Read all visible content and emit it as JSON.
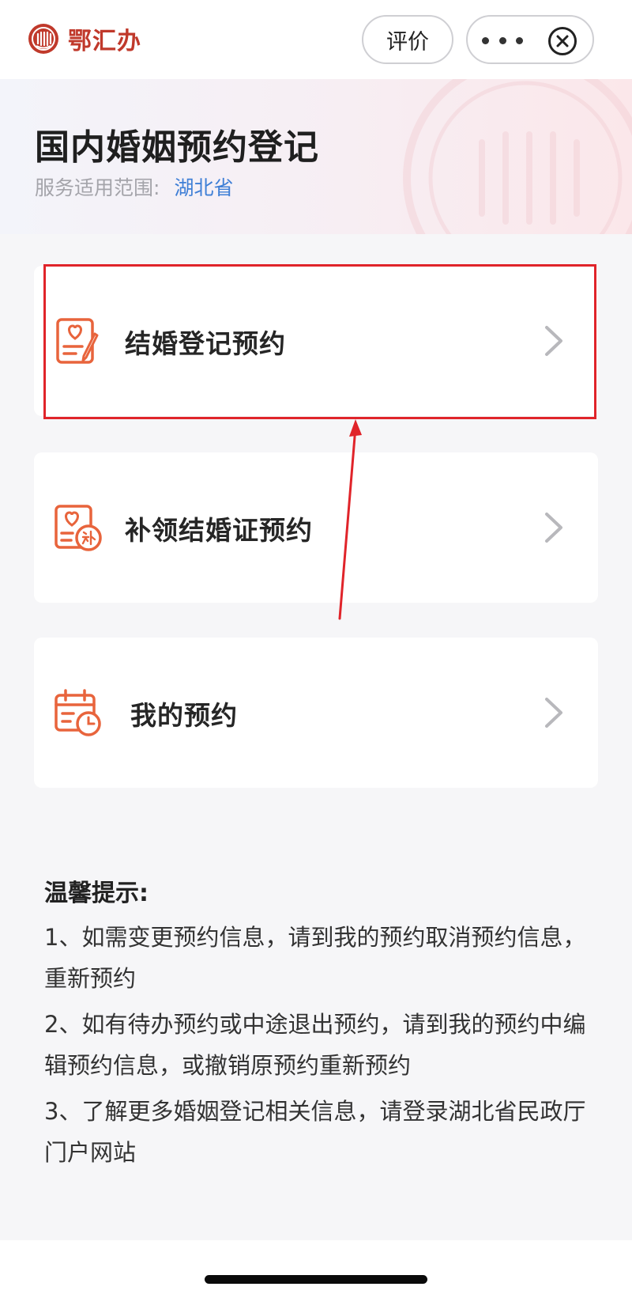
{
  "topbar": {
    "brand_name": "鄂汇办",
    "brand_icon": "emblem-icon",
    "rate_label": "评价",
    "more_icon": "more-dots-icon",
    "close_icon": "close-circle-icon"
  },
  "header": {
    "title": "国内婚姻预约登记",
    "scope_label": "服务适用范围:",
    "scope_value": "湖北省"
  },
  "services": [
    {
      "label": "结婚登记预约",
      "icon": "heart-document-icon"
    },
    {
      "label": "补领结婚证预约",
      "icon": "heart-document-reissue-icon"
    },
    {
      "label": "我的预约",
      "icon": "calendar-clock-icon"
    }
  ],
  "tips": {
    "title": "温馨提示:",
    "items": [
      "1、如需变更预约信息，请到我的预约取消预约信息，重新预约",
      "2、如有待办预约或中途退出预约，请到我的预约中编辑预约信息，或撤销原预约重新预约",
      "3、了解更多婚姻登记相关信息，请登录湖北省民政厅门户网站"
    ]
  },
  "colors": {
    "accent": "#e8643c",
    "brand_red": "#c0392b",
    "highlight": "#e0242a",
    "link_blue": "#3f7fd6"
  }
}
